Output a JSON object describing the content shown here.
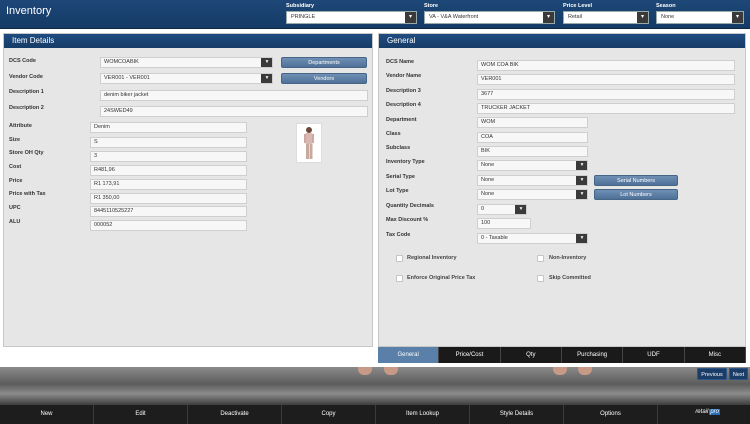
{
  "app": {
    "title": "Inventory"
  },
  "topbar": {
    "subsidiary": {
      "label": "Subsidiary",
      "value": "PRINGLE"
    },
    "store": {
      "label": "Store",
      "value": "VA - V&A Waterfront"
    },
    "price_level": {
      "label": "Price Level",
      "value": "Retail"
    },
    "season": {
      "label": "Season",
      "value": "None"
    }
  },
  "item_details": {
    "title": "Item Details",
    "dcs_code": {
      "label": "DCS Code",
      "value": "WOMCOABIK"
    },
    "vendor_code": {
      "label": "Vendor Code",
      "value": "VER001 - VER001"
    },
    "description1": {
      "label": "Description 1",
      "value": "denim biker jacket"
    },
    "description2": {
      "label": "Description 2",
      "value": "24SWED49"
    },
    "attribute": {
      "label": "Attribute",
      "value": "Denim"
    },
    "size": {
      "label": "Size",
      "value": "S"
    },
    "store_oh_qty": {
      "label": "Store OH Qty",
      "value": "3"
    },
    "cost": {
      "label": "Cost",
      "value": "R481,96"
    },
    "price": {
      "label": "Price",
      "value": "R1 173,91"
    },
    "price_with_tax": {
      "label": "Price with Tax",
      "value": "R1 350,00"
    },
    "upc": {
      "label": "UPC",
      "value": "8445110525227"
    },
    "alu": {
      "label": "ALU",
      "value": "000052"
    },
    "departments_button": "Departments",
    "vendors_button": "Vendors"
  },
  "general": {
    "title": "General",
    "dcs_name": {
      "label": "DCS Name",
      "value": "WOM COA BIK"
    },
    "vendor_name": {
      "label": "Vendor Name",
      "value": "VER001"
    },
    "description3": {
      "label": "Description 3",
      "value": "3677"
    },
    "description4": {
      "label": "Description 4",
      "value": "TRUCKER JACKET"
    },
    "department": {
      "label": "Department",
      "value": "WOM"
    },
    "class": {
      "label": "Class",
      "value": "COA"
    },
    "subclass": {
      "label": "Subclass",
      "value": "BIK"
    },
    "inventory_type": {
      "label": "Inventory Type",
      "value": "None"
    },
    "serial_type": {
      "label": "Serial Type",
      "value": "None"
    },
    "lot_type": {
      "label": "Lot Type",
      "value": "None"
    },
    "quantity_decimals": {
      "label": "Quantity Decimals",
      "value": "0"
    },
    "max_discount": {
      "label": "Max Discount %",
      "value": "100"
    },
    "tax_code": {
      "label": "Tax Code",
      "value": "0 - Taxable"
    },
    "serial_numbers_button": "Serial Numbers",
    "lot_numbers_button": "Lot Numbers",
    "checkboxes": {
      "regional_inventory": "Regional Inventory",
      "non_inventory": "Non-Inventory",
      "enforce_original_price_tax": "Enforce Original Price Tax",
      "skip_committed": "Skip Committed"
    }
  },
  "tabs": [
    "General",
    "Price/Cost",
    "Qty",
    "Purchasing",
    "UDF",
    "Misc"
  ],
  "nav": {
    "previous": "Previous",
    "next": "Next"
  },
  "toolbar": [
    "New",
    "Edit",
    "Deactivate",
    "Copy",
    "Item Lookup",
    "Style Details",
    "Options"
  ],
  "logo": {
    "text_a": "retail",
    "text_b": "pro"
  },
  "colors": {
    "header": "#163c68",
    "accent_button": "#5a7fa8",
    "toolbar": "#1d1d1d"
  }
}
